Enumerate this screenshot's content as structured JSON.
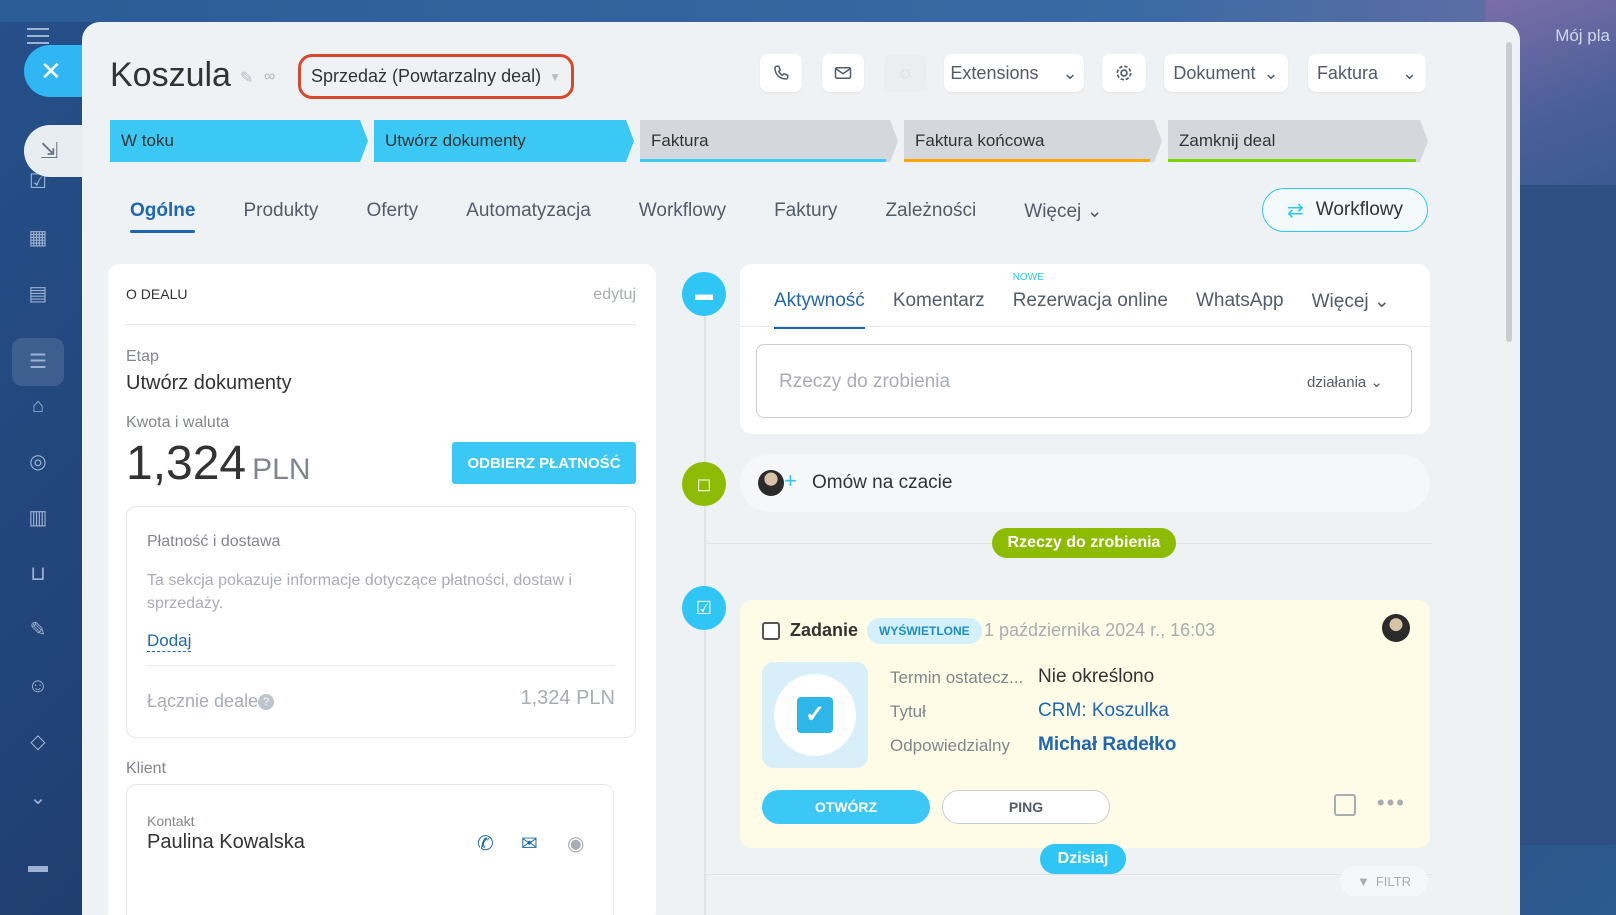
{
  "background": {
    "corner_text": "Mój pla"
  },
  "deal": {
    "title": "Koszula",
    "category": "Sprzedaż (Powtarzalny deal)"
  },
  "toolbar": {
    "extensions": "Extensions",
    "document": "Dokument",
    "invoice": "Faktura"
  },
  "stages": [
    {
      "label": "W toku",
      "color": "#3bc8f5"
    },
    {
      "label": "Utwórz dokumenty",
      "color": "#3bc8f5"
    },
    {
      "label": "Faktura",
      "color": "#3bc8f5"
    },
    {
      "label": "Faktura końcowa",
      "color": "#f7a700"
    },
    {
      "label": "Zamknij deal",
      "color": "#7bd500"
    }
  ],
  "tabs": [
    "Ogólne",
    "Produkty",
    "Oferty",
    "Automatyzacja",
    "Workflowy",
    "Faktury",
    "Zależności",
    "Więcej"
  ],
  "workflow_button": "Workflowy",
  "about": {
    "heading": "O DEALU",
    "edit": "edytuj",
    "stage_label": "Etap",
    "stage_value": "Utwórz dokumenty",
    "amount_label": "Kwota i waluta",
    "amount": "1,324",
    "currency": "PLN",
    "pay_button": "ODBIERZ PŁATNOŚĆ",
    "payment": {
      "title": "Płatność i dostawa",
      "description": "Ta sekcja pokazuje informacje dotyczące płatności, dostaw i sprzedaży.",
      "add": "Dodaj",
      "total_label": "Łącznie deale",
      "total_value": "1,324 PLN"
    },
    "client_label": "Klient",
    "contact_label": "Kontakt",
    "contact_name": "Paulina Kowalska"
  },
  "activity": {
    "tabs": [
      "Aktywność",
      "Komentarz",
      "Rezerwacja online",
      "WhatsApp",
      "Więcej"
    ],
    "new_badge": "NOWE",
    "todo_placeholder": "Rzeczy do zrobienia",
    "actions": "działania",
    "chat": "Omów na czacie"
  },
  "todo_pill": "Rzeczy do zrobienia",
  "task": {
    "title": "Zadanie",
    "badge": "WYŚWIETLONE",
    "date": "1 października 2024 r., 16:03",
    "deadline_label": "Termin ostatecz...",
    "deadline_value": "Nie określono",
    "title_label": "Tytuł",
    "title_value": "CRM: Koszulka",
    "responsible_label": "Odpowiedzialny",
    "responsible_value": "Michał Radełko",
    "open": "OTWÓRZ",
    "ping": "PING"
  },
  "today_pill": "Dzisiaj",
  "filter": "FILTR"
}
